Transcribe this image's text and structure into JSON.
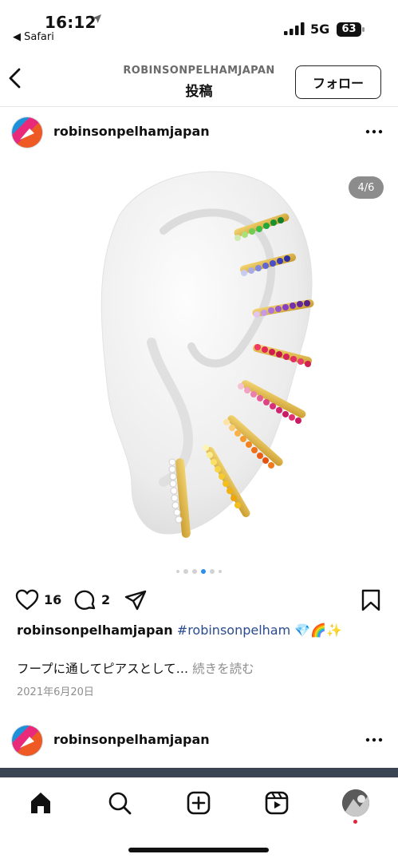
{
  "status_bar": {
    "time": "16:12",
    "back_app": "◀ Safari",
    "network": "5G",
    "battery": "63"
  },
  "nav": {
    "account_upper": "ROBINSONPELHAMJAPAN",
    "title": "投稿",
    "follow_label": "フォロー"
  },
  "post": {
    "username": "robinsonpelhamjapan",
    "media_counter": "4/6",
    "carousel_total_dots": 6,
    "carousel_active_index": 3,
    "like_count": "16",
    "comment_count": "2",
    "caption_user": "robinsonpelhamjapan",
    "caption_hashtag": "#robinsonpelham",
    "caption_emoji": "💎🌈✨",
    "caption_text": "フープに通してピアスとして…",
    "read_more": "続きを読む",
    "date": "2021年6月20日"
  },
  "next_post": {
    "username": "robinsonpelhamjapan"
  },
  "icons": {
    "like": "heart-icon",
    "comment": "comment-icon",
    "share": "send-icon",
    "save": "bookmark-icon",
    "tabs": [
      "home-icon",
      "search-icon",
      "create-icon",
      "reels-icon",
      "profile-avatar"
    ]
  },
  "colors": {
    "hashtag": "#2b4b8f",
    "active_dot": "#2f8fe8",
    "notification_dot": "#e0243a"
  }
}
